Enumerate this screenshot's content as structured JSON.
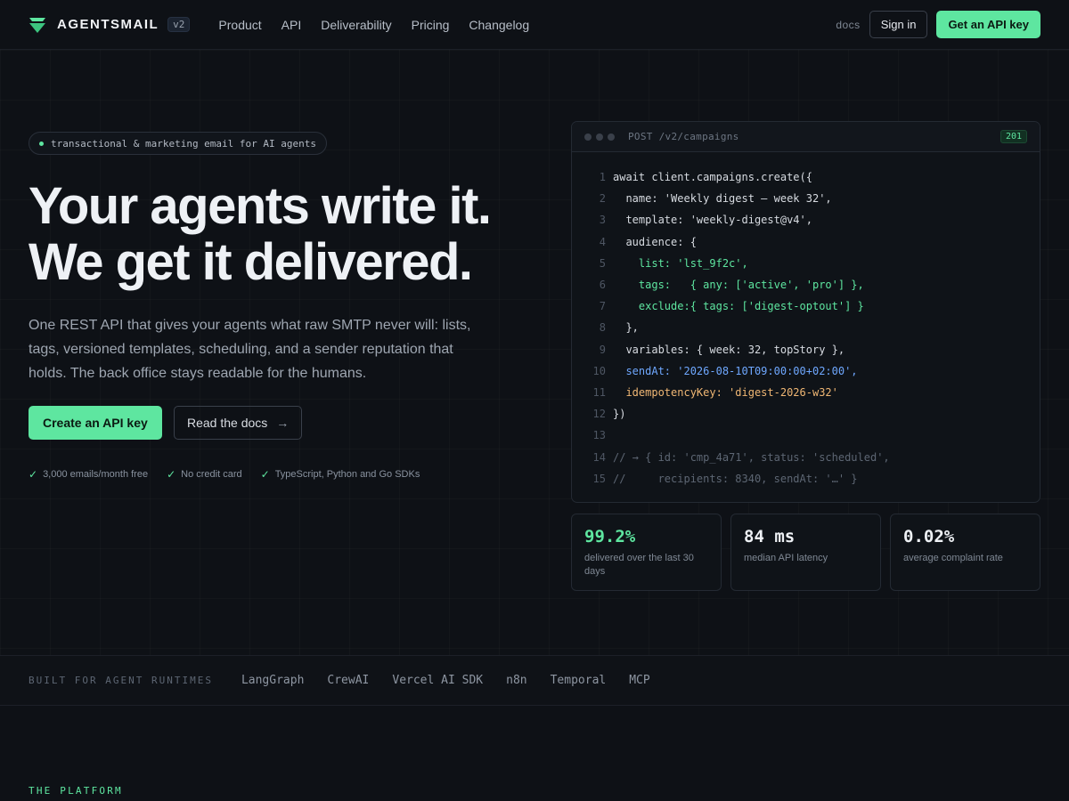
{
  "nav": {
    "brand": "AGENTSMAIL",
    "version": "v2",
    "links": [
      "Product",
      "API",
      "Deliverability",
      "Pricing",
      "Changelog"
    ],
    "docs": "docs",
    "sign_in": "Sign in",
    "get_key": "Get an API key"
  },
  "hero": {
    "pill": "transactional & marketing email for AI agents",
    "headline_1": "Your agents write it.",
    "headline_2": "We get it delivered.",
    "subtext": "One REST API that gives your agents what raw SMTP never will: lists, tags, versioned templates, scheduling, and a sender reputation that holds. The back office stays readable for the humans.",
    "cta_primary": "Create an API key",
    "cta_secondary": "Read the docs",
    "cta_arrow": "→",
    "perks": [
      "3,000 emails/month free",
      "No credit card",
      "TypeScript, Python and Go SDKs"
    ],
    "check": "✓"
  },
  "code": {
    "endpoint": "POST /v2/campaigns",
    "status": "201",
    "lines": [
      {
        "n": "1",
        "t": "await client.campaigns.create({",
        "c": "def"
      },
      {
        "n": "2",
        "t": "  name: 'Weekly digest — week 32',",
        "c": "def"
      },
      {
        "n": "3",
        "t": "  template: 'weekly-digest@v4',",
        "c": "def"
      },
      {
        "n": "4",
        "t": "  audience: {",
        "c": "def"
      },
      {
        "n": "5",
        "t": "    list: 'lst_9f2c',",
        "c": "green"
      },
      {
        "n": "6",
        "t": "    tags:   { any: ['active', 'pro'] },",
        "c": "green"
      },
      {
        "n": "7",
        "t": "    exclude:{ tags: ['digest-optout'] }",
        "c": "green"
      },
      {
        "n": "8",
        "t": "  },",
        "c": "def"
      },
      {
        "n": "9",
        "t": "  variables: { week: 32, topStory },",
        "c": "def"
      },
      {
        "n": "10",
        "t": "  sendAt: '2026-08-10T09:00:00+02:00',",
        "c": "blue"
      },
      {
        "n": "11",
        "t": "  idempotencyKey: 'digest-2026-w32'",
        "c": "orange"
      },
      {
        "n": "12",
        "t": "})",
        "c": "def"
      },
      {
        "n": "13",
        "t": "",
        "c": "def"
      },
      {
        "n": "14",
        "t": "// → { id: 'cmp_4a71', status: 'scheduled',",
        "c": "dim"
      },
      {
        "n": "15",
        "t": "//     recipients: 8340, sendAt: '…' }",
        "c": "dim"
      }
    ]
  },
  "stats": [
    {
      "value": "99.2%",
      "label": "delivered over the last 30 days",
      "accent": true
    },
    {
      "value": "84 ms",
      "label": "median API latency",
      "accent": false
    },
    {
      "value": "0.02%",
      "label": "average complaint rate",
      "accent": false
    }
  ],
  "runtimes": {
    "label": "BUILT FOR AGENT RUNTIMES",
    "items": [
      "LangGraph",
      "CrewAI",
      "Vercel AI SDK",
      "n8n",
      "Temporal",
      "MCP"
    ]
  },
  "platform_label": "THE PLATFORM",
  "colors": {
    "accent": "#5ee6a0",
    "background": "#0e1116",
    "blue": "#6fa8ff",
    "orange": "#f0b774"
  }
}
